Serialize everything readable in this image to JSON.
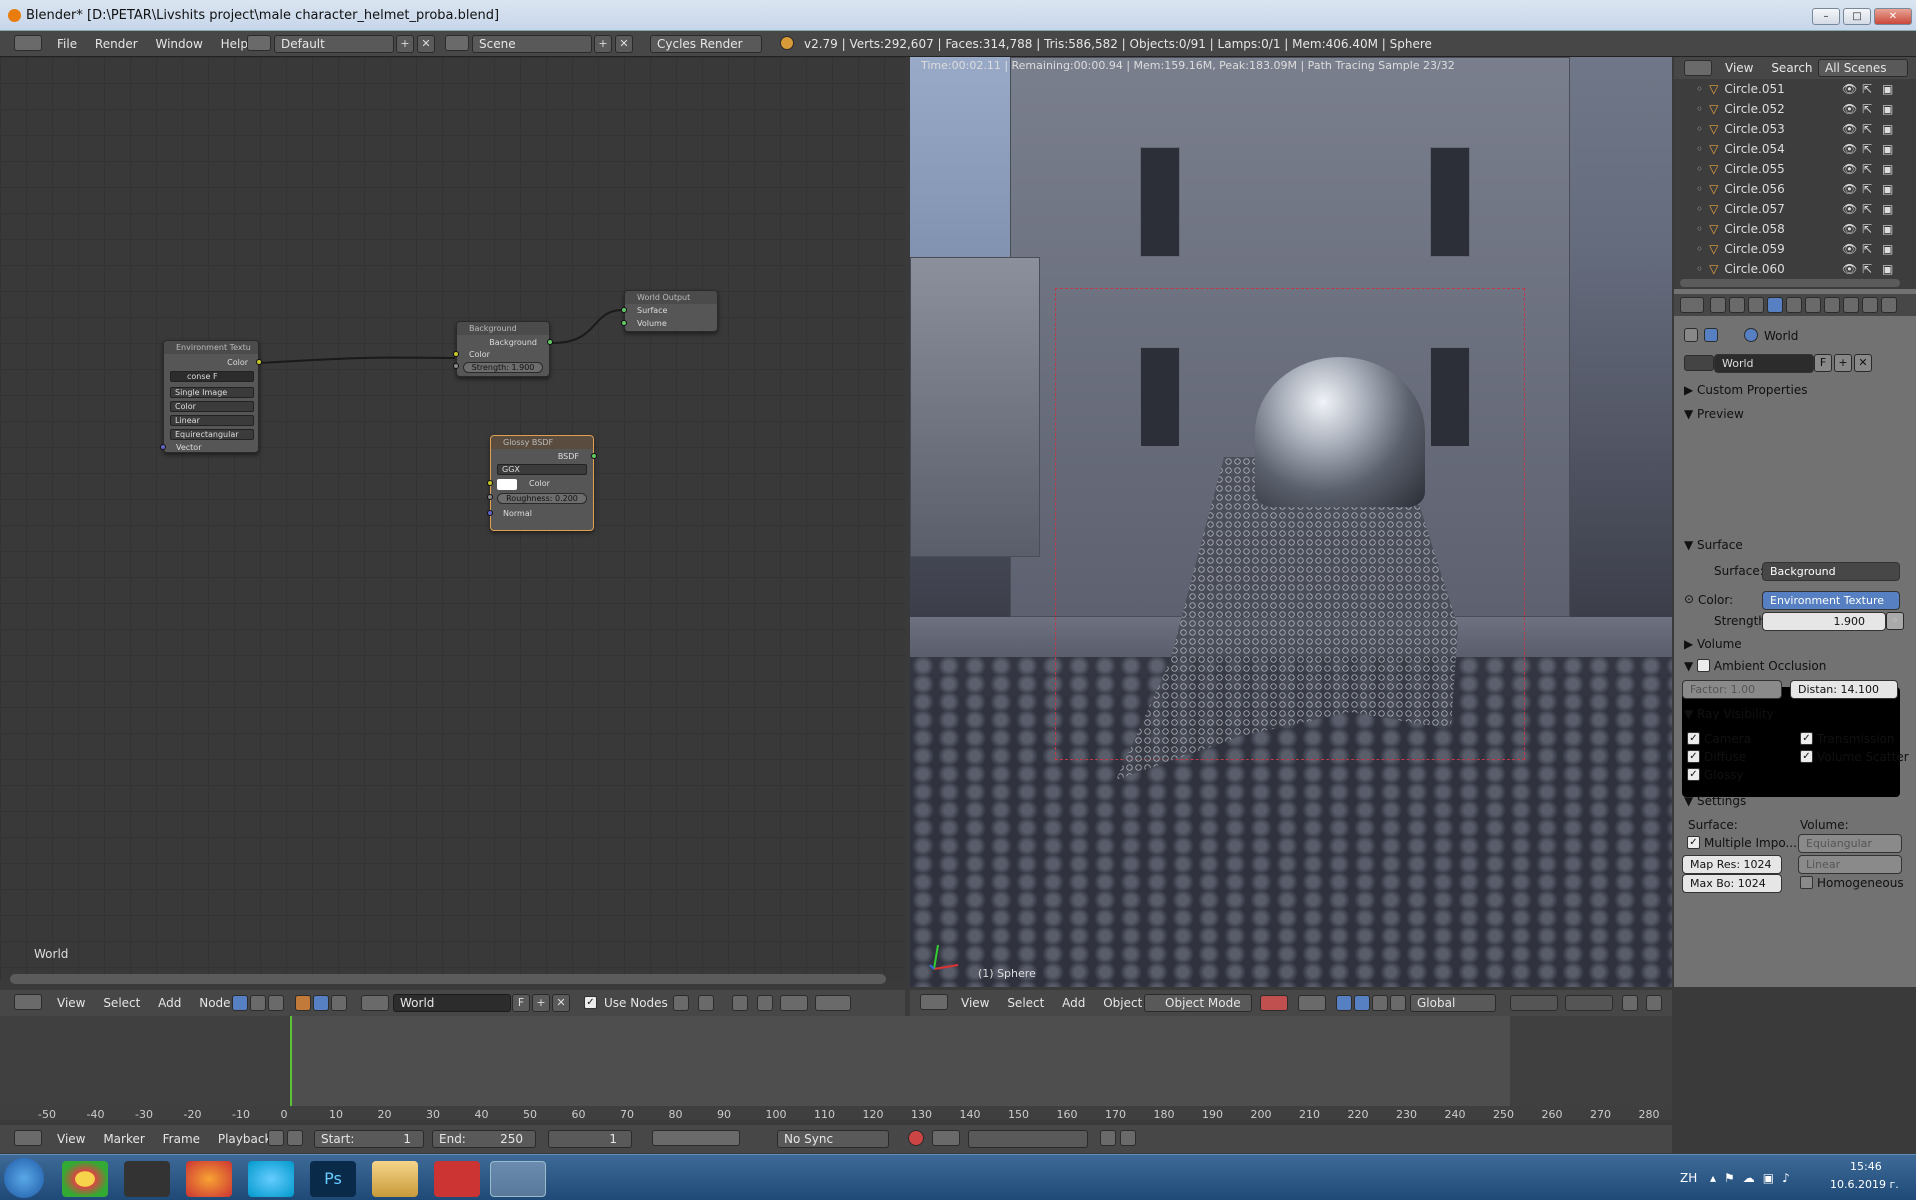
{
  "window": {
    "title": "Blender* [D:\\PETAR\\Livshits project\\male character_helmet_proba.blend]",
    "minimize": "–",
    "maximize": "□",
    "close": "✕"
  },
  "info_header": {
    "menus": [
      "File",
      "Render",
      "Window",
      "Help"
    ],
    "layout": "Default",
    "scene": "Scene",
    "engine": "Cycles Render",
    "stats": "v2.79 | Verts:292,607 | Faces:314,788 | Tris:586,582 | Objects:0/91 | Lamps:0/1 | Mem:406.40M | Sphere"
  },
  "node_editor": {
    "label": "World",
    "nodes": {
      "env": {
        "title": "Environment Textu",
        "out": "Color",
        "image": "conse",
        "f": "F",
        "opt1": "Single Image",
        "opt2": "Color",
        "opt3": "Linear",
        "opt4": "Equirectangular",
        "in": "Vector"
      },
      "bg": {
        "title": "Background",
        "out": "Background",
        "in": "Color",
        "strength": "Strength: 1.900"
      },
      "wo": {
        "title": "World Output",
        "in1": "Surface",
        "in2": "Volume"
      },
      "glossy": {
        "title": "Glossy BSDF",
        "out": "BSDF",
        "dist": "GGX",
        "color": "Color",
        "roughness": "Roughness: 0.200",
        "normal": "Normal"
      }
    },
    "header": {
      "menus": [
        "View",
        "Select",
        "Add",
        "Node"
      ],
      "world": "World",
      "f": "F",
      "use_nodes": "Use Nodes"
    }
  },
  "viewport": {
    "render_info": "Time:00:02.11 | Remaining:00:00.94 | Mem:159.16M, Peak:183.09M | Path Tracing Sample 23/32",
    "object": "(1) Sphere",
    "header": {
      "menus": [
        "View",
        "Select",
        "Add",
        "Object"
      ],
      "mode": "Object Mode",
      "orientation": "Global"
    }
  },
  "outliner": {
    "tabs": [
      "View",
      "Search",
      "All Scenes"
    ],
    "items": [
      "Circle.051",
      "Circle.052",
      "Circle.053",
      "Circle.054",
      "Circle.055",
      "Circle.056",
      "Circle.057",
      "Circle.058",
      "Circle.059",
      "Circle.060"
    ]
  },
  "properties": {
    "context": "World",
    "world_name": "World",
    "f": "F",
    "custom_properties": "Custom Properties",
    "preview": "Preview",
    "surface": {
      "title": "Surface",
      "surface_label": "Surface:",
      "surface_value": "Background",
      "color_label": "Color:",
      "color_value": "Environment Texture",
      "strength_label": "Strength:",
      "strength_value": "1.900"
    },
    "volume": "Volume",
    "ao": {
      "title": "Ambient Occlusion",
      "factor": "Factor:     1.00",
      "distance": "Distan: 14.100"
    },
    "ray_visibility": {
      "title": "Ray Visibility",
      "camera": "Camera",
      "transmission": "Transmission",
      "diffuse": "Diffuse",
      "volume_scatter": "Volume Scatter",
      "glossy": "Glossy"
    },
    "settings": {
      "title": "Settings",
      "surface_label": "Surface:",
      "volume_label": "Volume:",
      "mis": "Multiple Impo...",
      "map_res": "Map Res: 1024",
      "max_bo": "Max Bo:  1024",
      "vol_sampling": "Equiangular",
      "vol_interp": "Linear",
      "homogeneous": "Homogeneous"
    }
  },
  "timeline": {
    "ticks": [
      "-50",
      "-40",
      "-30",
      "-20",
      "-10",
      "0",
      "10",
      "20",
      "30",
      "40",
      "50",
      "60",
      "70",
      "80",
      "90",
      "100",
      "110",
      "120",
      "130",
      "140",
      "150",
      "160",
      "170",
      "180",
      "190",
      "200",
      "210",
      "220",
      "230",
      "240",
      "250",
      "260",
      "270",
      "280"
    ],
    "menus": [
      "View",
      "Marker",
      "Frame",
      "Playback"
    ],
    "start": "Start:",
    "start_val": "1",
    "end": "End:",
    "end_val": "250",
    "current": "1",
    "sync": "No Sync"
  },
  "taskbar": {
    "lang": "ZH",
    "time": "15:46",
    "date": "10.6.2019 г."
  },
  "colors": {
    "socket_yellow": "#c7c729",
    "socket_green": "#63c763",
    "socket_purple": "#6363c7",
    "selected_node": "#e0a050",
    "accent_blue": "#5680c2"
  }
}
